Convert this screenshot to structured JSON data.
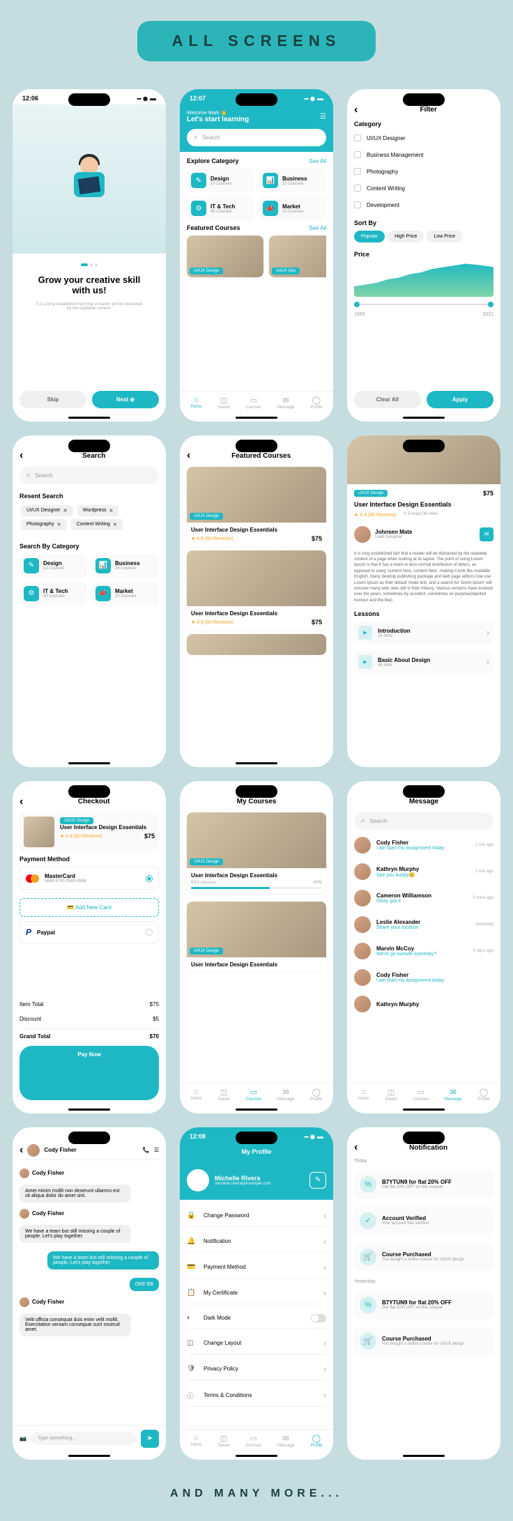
{
  "header": "ALL SCREENS",
  "footer": "AND MANY MORE...",
  "colors": {
    "accent": "#1eb8c4",
    "bg": "#c5dde0"
  },
  "times": {
    "t1": "12:06",
    "t2": "12:07",
    "t3": "12:08"
  },
  "onboarding": {
    "title": "Grow your creative skill with us!",
    "subtitle": "It is a long established fact that a reader will be distracted by the readable content.",
    "skip": "Skip",
    "next": "Next"
  },
  "home": {
    "welcome": "Welcome Mark 👋",
    "subtitle": "Let's start learning",
    "search": "Search",
    "explore": "Explore Category",
    "featured": "Featured Courses",
    "see_all": "See All",
    "categories": [
      {
        "name": "Design",
        "sub": "10 Courses",
        "icon": "✎"
      },
      {
        "name": "Business",
        "sub": "25 Courses",
        "icon": "📊"
      },
      {
        "name": "IT & Tech",
        "sub": "40 Courses",
        "icon": "⚙"
      },
      {
        "name": "Market",
        "sub": "10 Courses",
        "icon": "📣"
      }
    ]
  },
  "nav": [
    {
      "label": "Home",
      "icon": "⌂"
    },
    {
      "label": "Saved",
      "icon": "◫"
    },
    {
      "label": "Courses",
      "icon": "▭"
    },
    {
      "label": "Message",
      "icon": "✉"
    },
    {
      "label": "Profile",
      "icon": "◯"
    }
  ],
  "filter": {
    "title": "Filter",
    "category": "Category",
    "options": [
      "UI/UX Designer",
      "Business Management",
      "Photography",
      "Content Writing",
      "Development"
    ],
    "sort": "Sort By",
    "sort_options": [
      "Popular",
      "High Price",
      "Low Price"
    ],
    "price": "Price",
    "range": [
      "1995",
      "2021"
    ],
    "clear": "Clear All",
    "apply": "Apply"
  },
  "search": {
    "title": "Search",
    "placeholder": "Search",
    "recent": "Resent Search",
    "chips": [
      "UI/UX Designer",
      "Wordpress",
      "Photography",
      "Content Writing"
    ],
    "by_cat": "Search By Category"
  },
  "featured_page": {
    "title": "Featured Courses"
  },
  "course": {
    "tag": "UI/UX Design",
    "title": "User Interface Design Essentials",
    "rating": "4.8 (60 Reviews)",
    "price": "$75",
    "instructor": "Johnsen Mate",
    "role": "Lead Designer",
    "duration": "5 hours 30 mins",
    "description": "It is long established fact that a reader will be distracted by the readable content of a page when looking at its layout. The point of using Lorem Ipsum is that it has a more-or-less normal distribution of letters, as opposed to using 'content here, content here', making it look like readable English. Many desktop publishing package and web page editors now use Lorem Ipsum as their default mode text, and a search for 'lorem ipsum' will uncover many web sites still in their infancy. Various versions have evolved over the years, sometimes by accident, sometimes on purpose(injected humour and the like).",
    "lessons": "Lessons",
    "lesson_list": [
      {
        "title": "Introduction",
        "sub": "15 mins"
      },
      {
        "title": "Basic About Design",
        "sub": "45 mins"
      }
    ]
  },
  "checkout": {
    "title": "Checkout",
    "payment": "Payment Method",
    "mastercard": "MasterCard",
    "mc_num": "5689-4700-2589-9658",
    "add_card": "Add New Card",
    "paypal": "Paypal",
    "item_total": "Item Total",
    "item_total_val": "$75",
    "discount": "Discount",
    "discount_val": "$5",
    "grand": "Grand Total",
    "grand_val": "$70",
    "pay": "Pay Now"
  },
  "my_courses": {
    "title": "My Courses",
    "progress": "5/10 Lessons",
    "percent": "60%"
  },
  "messages": {
    "title": "Message",
    "search": "Search",
    "list": [
      {
        "name": "Cody Fisher",
        "msg": "I am start my assignment today",
        "time": "2 min ago"
      },
      {
        "name": "Kathryn Murphy",
        "msg": "See you buddy😊",
        "time": "2 min ago"
      },
      {
        "name": "Cameron Williamson",
        "msg": "Okay, got it",
        "time": "5 mins ago"
      },
      {
        "name": "Leslie Alexander",
        "msg": "Share your location",
        "time": "Yesterday"
      },
      {
        "name": "Marvin McCoy",
        "msg": "We're go outside someday?",
        "time": "4 days ago"
      },
      {
        "name": "Cody Fisher",
        "msg": "I am start my assignment today",
        "time": ""
      },
      {
        "name": "Kathryn Murphy",
        "msg": "",
        "time": ""
      }
    ]
  },
  "chat": {
    "name": "Cody Fisher",
    "msgs": [
      {
        "sender": "Cody Fisher",
        "text": "Amet minim mollit non deserunt ullamco est sit aliqua dolor do amet sint.",
        "sent": false
      },
      {
        "sender": "Cody Fisher",
        "text": "We have a team but still missing a couple of people. Let's play together.",
        "sent": false
      },
      {
        "text": "We have a team but still missing a couple of people. Let's play together",
        "sent": true
      },
      {
        "text": "OKE BB",
        "sent": true
      },
      {
        "sender": "Cody Fisher",
        "text": "Velit officia consequat duis enim velit mollit. Exercitation veniam consequat sunt nostrud amet.",
        "sent": false
      }
    ],
    "input": "Type something..."
  },
  "profile": {
    "title": "My Profile",
    "name": "Michelle Rivera",
    "email": "michelle.rivera@example.com",
    "settings": [
      {
        "icon": "🔒",
        "label": "Change Password"
      },
      {
        "icon": "🔔",
        "label": "Notification"
      },
      {
        "icon": "💳",
        "label": "Payment Method"
      },
      {
        "icon": "📋",
        "label": "My Certificate"
      },
      {
        "icon": "◐",
        "label": "Dark Mode",
        "toggle": true
      },
      {
        "icon": "◫",
        "label": "Change Layout"
      },
      {
        "icon": "🛡",
        "label": "Privacy Policy"
      },
      {
        "icon": "ⓘ",
        "label": "Terms & Conditions"
      }
    ]
  },
  "notifications": {
    "title": "Notification",
    "today": "Today",
    "yesterday": "Yesterday",
    "items": [
      {
        "icon": "%",
        "title": "B7YTUN9 for flat 20% OFF",
        "sub": "Get flat 20% OFF on this coupon"
      },
      {
        "icon": "✓",
        "title": "Account Verified",
        "sub": "Your account has verified"
      },
      {
        "icon": "🛒",
        "title": "Course Purchased",
        "sub": "You bought a online course for UI/UX design"
      }
    ],
    "yesterday_items": [
      {
        "icon": "%",
        "title": "B7YTUN9 for flat 20% OFF",
        "sub": "Get flat 20% OFF on this coupon"
      },
      {
        "icon": "🛒",
        "title": "Course Purchased",
        "sub": "You bought a online course for UI/UX design"
      }
    ]
  }
}
